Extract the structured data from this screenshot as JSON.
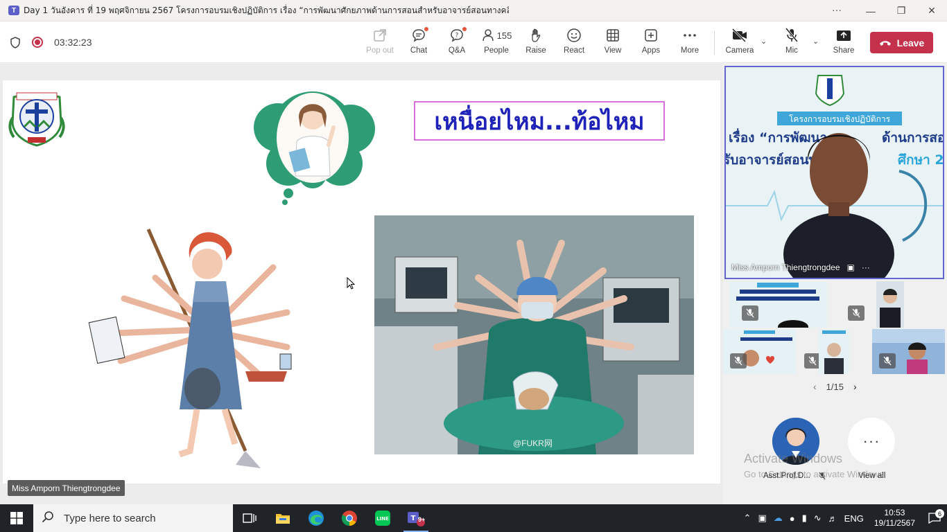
{
  "window": {
    "title": "Day 1 วันอังคาร ที่ 19 พฤศจิกายน 2567 โครงการอบรมเชิงปฏิบัติการ เรื่อง “การพัฒนาศักยภาพด้านการสอนสำหรับอาจารย์สอนทางคลิ...",
    "more_label": "···"
  },
  "toolbar": {
    "timer": "03:32:23",
    "buttons": [
      {
        "label": "Pop out"
      },
      {
        "label": "Chat"
      },
      {
        "label": "Q&A"
      },
      {
        "label": "People",
        "count": "155"
      },
      {
        "label": "Raise"
      },
      {
        "label": "React"
      },
      {
        "label": "View"
      },
      {
        "label": "Apps"
      },
      {
        "label": "More"
      },
      {
        "label": "Camera"
      },
      {
        "label": "Mic"
      },
      {
        "label": "Share"
      }
    ],
    "leave_label": "Leave"
  },
  "slide": {
    "title": "เหนื่อยไหม...ท้อไหม",
    "photo_watermark": "@FUKR网",
    "presenter_tag": "Miss Amporn Thiengtrongdee"
  },
  "right_panel": {
    "main_video_name": "Miss Amporn Thiengtrongdee",
    "pager": "1/15",
    "avatar_name": "Asst.Prof.D...",
    "view_all_label": "View all",
    "watermark_line1": "Activate Windows",
    "watermark_line2": "Go to Settings to activate Windows."
  },
  "taskbar": {
    "search_placeholder": "Type here to search",
    "language": "ENG",
    "time": "10:53",
    "date": "19/11/2567",
    "notification_count": "6",
    "teams_badge": "9+"
  },
  "colors": {
    "accent": "#6264d0",
    "leave": "#c4314b",
    "slide_title": "#1e22b8"
  }
}
